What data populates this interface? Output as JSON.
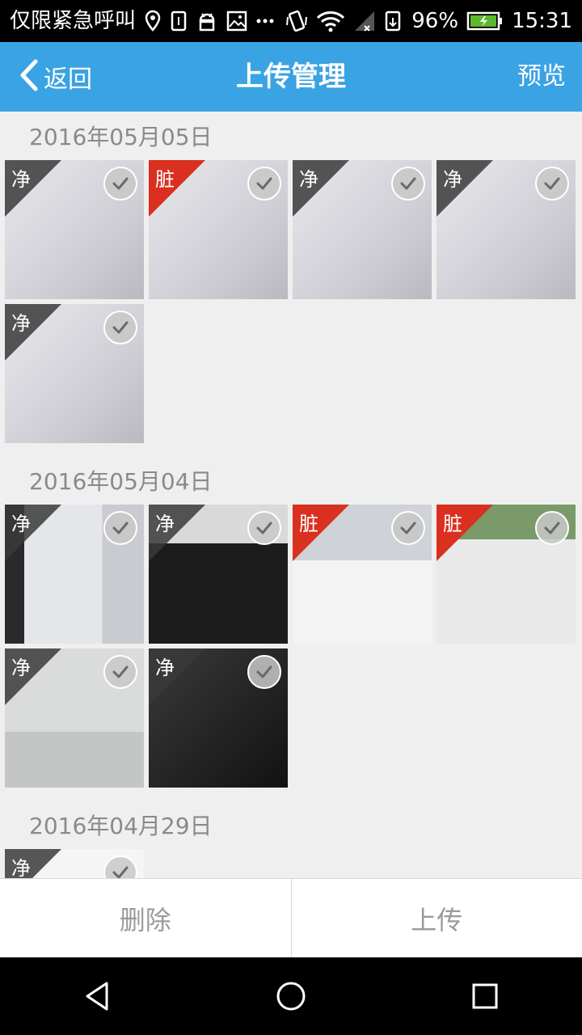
{
  "status_bar": {
    "carrier": "仅限紧急呼叫",
    "battery": "96%",
    "time": "15:31"
  },
  "header": {
    "back_label": "返回",
    "title": "上传管理",
    "preview_label": "预览",
    "color": "#3aa3e3"
  },
  "sections": [
    {
      "date": "2016年05月05日",
      "photos": [
        {
          "tag": "净",
          "status": "clean",
          "scene": "screen"
        },
        {
          "tag": "脏",
          "status": "dirty",
          "scene": "screen"
        },
        {
          "tag": "净",
          "status": "clean",
          "scene": "screen"
        },
        {
          "tag": "净",
          "status": "clean",
          "scene": "screen"
        },
        {
          "tag": "净",
          "status": "clean",
          "scene": "screen"
        }
      ]
    },
    {
      "date": "2016年05月04日",
      "photos": [
        {
          "tag": "净",
          "status": "clean",
          "scene": "monitor"
        },
        {
          "tag": "净",
          "status": "clean",
          "scene": "keyboard"
        },
        {
          "tag": "脏",
          "status": "dirty",
          "scene": "desk"
        },
        {
          "tag": "脏",
          "status": "dirty",
          "scene": "cup"
        },
        {
          "tag": "净",
          "status": "clean",
          "scene": "code"
        },
        {
          "tag": "净",
          "status": "clean",
          "scene": "keyboard-dark"
        }
      ]
    },
    {
      "date": "2016年04月29日",
      "photos": [
        {
          "tag": "净",
          "status": "clean",
          "scene": "keyboard-white"
        }
      ]
    }
  ],
  "actions": {
    "delete_label": "删除",
    "upload_label": "上传"
  },
  "colors": {
    "dirty_tag": "#d9301f",
    "clean_tag": "#3a3a3a"
  }
}
